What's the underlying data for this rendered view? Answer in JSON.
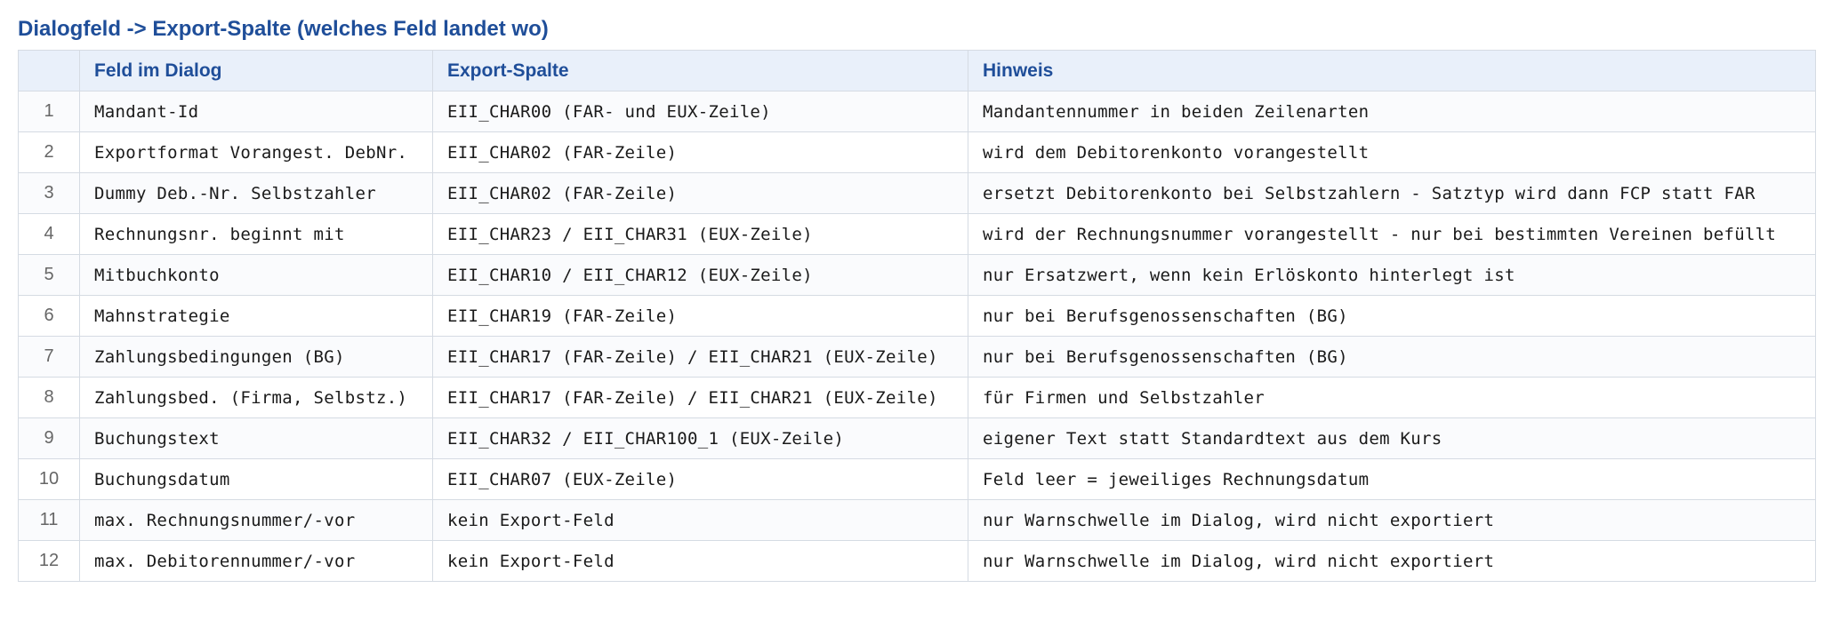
{
  "title": "Dialogfeld -> Export-Spalte (welches Feld landet wo)",
  "table": {
    "headers": [
      "",
      "Feld im Dialog",
      "Export-Spalte",
      "Hinweis"
    ],
    "rows": [
      {
        "num": "1",
        "field": "Mandant-Id",
        "column": "EII_CHAR00 (FAR- und EUX-Zeile)",
        "note": "Mandantennummer in beiden Zeilenarten"
      },
      {
        "num": "2",
        "field": "Exportformat Vorangest. DebNr.",
        "column": "EII_CHAR02 (FAR-Zeile)",
        "note": "wird dem Debitorenkonto vorangestellt"
      },
      {
        "num": "3",
        "field": "Dummy Deb.-Nr. Selbstzahler",
        "column": "EII_CHAR02 (FAR-Zeile)",
        "note": "ersetzt Debitorenkonto bei Selbstzahlern - Satztyp wird dann FCP statt FAR"
      },
      {
        "num": "4",
        "field": "Rechnungsnr. beginnt mit",
        "column": "EII_CHAR23 / EII_CHAR31 (EUX-Zeile)",
        "note": "wird der Rechnungsnummer vorangestellt - nur bei bestimmten Vereinen befüllt"
      },
      {
        "num": "5",
        "field": "Mitbuchkonto",
        "column": "EII_CHAR10 / EII_CHAR12 (EUX-Zeile)",
        "note": "nur Ersatzwert, wenn kein Erlöskonto hinterlegt ist"
      },
      {
        "num": "6",
        "field": "Mahnstrategie",
        "column": "EII_CHAR19 (FAR-Zeile)",
        "note": "nur bei Berufsgenossenschaften (BG)"
      },
      {
        "num": "7",
        "field": "Zahlungsbedingungen (BG)",
        "column": "EII_CHAR17 (FAR-Zeile) / EII_CHAR21 (EUX-Zeile)",
        "note": "nur bei Berufsgenossenschaften (BG)"
      },
      {
        "num": "8",
        "field": "Zahlungsbed. (Firma, Selbstz.)",
        "column": "EII_CHAR17 (FAR-Zeile) / EII_CHAR21 (EUX-Zeile)",
        "note": "für Firmen und Selbstzahler"
      },
      {
        "num": "9",
        "field": "Buchungstext",
        "column": "EII_CHAR32 / EII_CHAR100_1 (EUX-Zeile)",
        "note": "eigener Text statt Standardtext aus dem Kurs"
      },
      {
        "num": "10",
        "field": "Buchungsdatum",
        "column": "EII_CHAR07 (EUX-Zeile)",
        "note": "Feld leer = jeweiliges Rechnungsdatum"
      },
      {
        "num": "11",
        "field": "max. Rechnungsnummer/-vor",
        "column": "kein Export-Feld",
        "note": "nur Warnschwelle im Dialog, wird nicht exportiert"
      },
      {
        "num": "12",
        "field": "max. Debitorennummer/-vor",
        "column": "kein Export-Feld",
        "note": "nur Warnschwelle im Dialog, wird nicht exportiert"
      }
    ]
  }
}
